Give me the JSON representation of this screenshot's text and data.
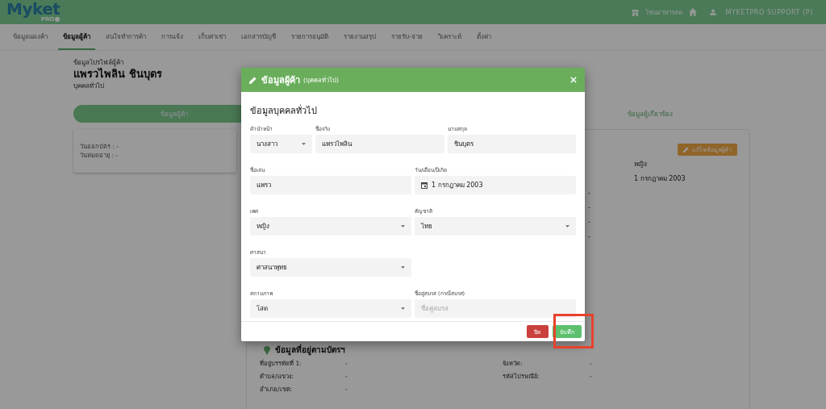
{
  "header": {
    "logo": "Myket",
    "logo_sub": "PRO",
    "store": "โซนอาหารสด",
    "user": "MYKETPRO SUPPORT (P)"
  },
  "nav_tabs": [
    {
      "label": "ข้อมูลแผงค้า",
      "selected": false
    },
    {
      "label": "ข้อมูลผู้ค้า",
      "selected": true
    },
    {
      "label": "สนใจทำการค้า",
      "selected": false
    },
    {
      "label": "การแจ้ง",
      "selected": false
    },
    {
      "label": "เก็บค่าเช่า",
      "selected": false
    },
    {
      "label": "เอกสารบัญชี",
      "selected": false
    },
    {
      "label": "รายการอนุมัติ",
      "selected": false
    },
    {
      "label": "รายงานสรุป",
      "selected": false
    },
    {
      "label": "รายรับ-จ่าย",
      "selected": false
    },
    {
      "label": "วิเคราะห์",
      "selected": false
    },
    {
      "label": "ตั้งค่า",
      "selected": false
    }
  ],
  "profile": {
    "caption": "ข้อมูลโปรไฟล์ผู้ค้า",
    "name": "แพรวไพลิน ชินบุตร",
    "type": "บุคคลทั่วไป"
  },
  "section_tabs": [
    {
      "label": "ข้อมูลผู้ค้า",
      "selected": true
    },
    {
      "label": "ข้อมูลผู้เกี่ยวข้อง",
      "selected": false
    }
  ],
  "id_card": {
    "lines": [
      "วันออกบัตร : -",
      "วันหมดอายุ : -"
    ]
  },
  "detail": {
    "edit_button": "แก้ไขข้อมูลผู้ค้า",
    "rows": [
      {
        "column_2": "หญิง"
      },
      {
        "column_2": "1 กรกฎาคม 2003"
      },
      {
        "column_1": "-"
      },
      {
        "column_1": "-"
      },
      {
        "column_1": "-"
      },
      {
        "column_1": "-"
      }
    ],
    "address": {
      "title": "ข้อมูลที่อยู่ตามบัตรฯ",
      "rows": [
        {
          "label_1": "ที่อยู่บรรทัดที่ 1:",
          "value_1": "-",
          "label_2": "จังหวัด:",
          "value_2": "-"
        },
        {
          "label_1": "ตำบล/แขวง:",
          "value_1": "-",
          "label_2": "รหัสไปรษณีย์:",
          "value_2": "-"
        },
        {
          "label_1": "อำเภอ/เขต:",
          "value_1": "-"
        }
      ]
    }
  },
  "modal": {
    "title": "ข้อมูลผู้ค้า",
    "subtitle": "(บุคคลทั่วไป)",
    "section": "ข้อมูลบุคคลทั่วไป",
    "rows": [
      [
        {
          "label": "คำนำหน้า",
          "kind": "select",
          "value": "นางสาว"
        },
        {
          "label": "ชื่อจริง",
          "kind": "text",
          "value": "แพรวไพลิน"
        },
        {
          "label": "นามสกุล",
          "kind": "text",
          "value": "ชินบุตร"
        }
      ],
      [
        {
          "label": "ชื่อเล่น",
          "kind": "text",
          "value": "แพรว"
        },
        {
          "label": "วัน/เดือน/ปีเกิด",
          "kind": "date",
          "value": "1 กรกฎาคม 2003"
        }
      ],
      [
        {
          "label": "เพศ",
          "kind": "select",
          "value": "หญิง"
        },
        {
          "label": "สัญชาติ",
          "kind": "select",
          "value": "ไทย"
        }
      ],
      [
        {
          "label": "ศาสนา",
          "kind": "select",
          "value": "ศาสนาพุทธ"
        }
      ],
      [
        {
          "label": "สถานภาพ",
          "kind": "select",
          "value": "โสด"
        },
        {
          "label": "ชื่อคู่สมรส (กรณีสมรส)",
          "kind": "text",
          "placeholder": "ชื่อคู่สมรส"
        }
      ]
    ],
    "buttons": [
      {
        "label": "ปิด",
        "kind": "close"
      },
      {
        "label": "บันทึก",
        "kind": "save"
      }
    ]
  }
}
